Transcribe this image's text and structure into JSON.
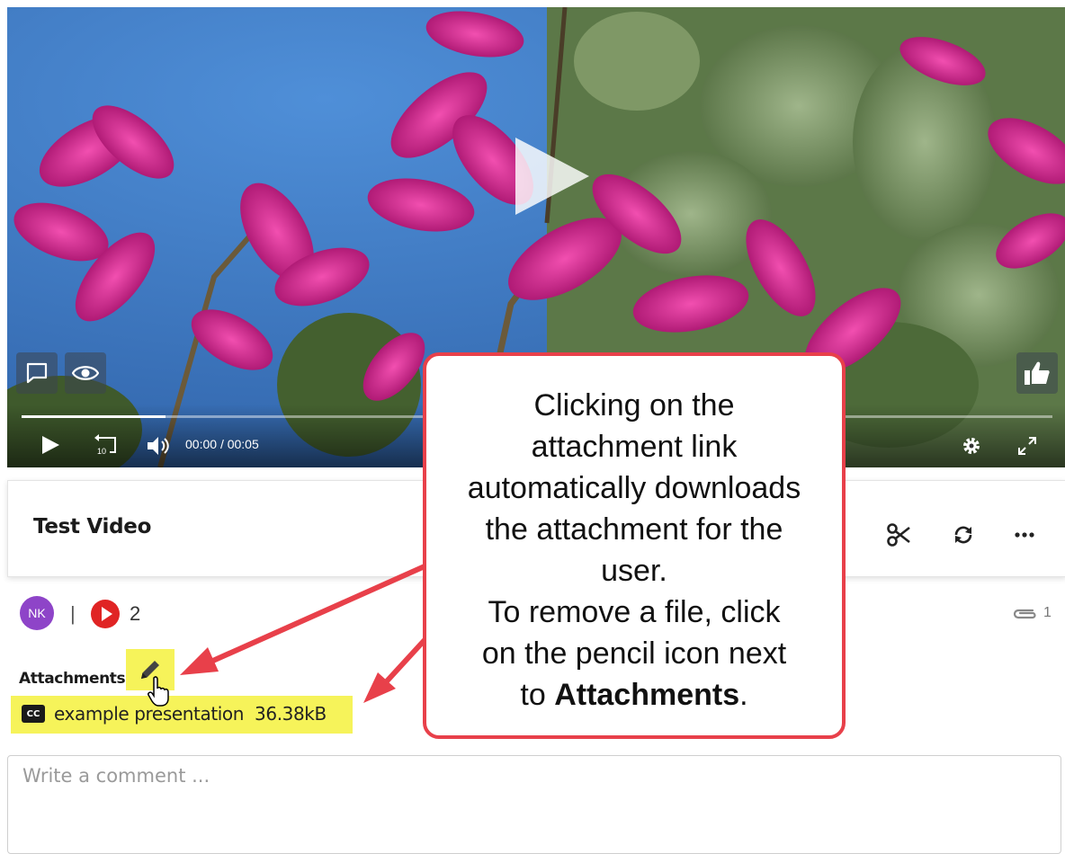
{
  "player": {
    "time_current": "00:00",
    "time_separator": "/",
    "time_total": "00:05",
    "progress": 0.14,
    "rewind_label": "10"
  },
  "video": {
    "title": "Test Video"
  },
  "meta": {
    "avatar_initials": "NK",
    "separator": "|",
    "view_count": "2",
    "attachment_count": "1"
  },
  "attachments": {
    "label": "Attachments",
    "items": [
      {
        "badge": "CC",
        "name": "example presentation",
        "size": "36.38kB"
      }
    ]
  },
  "comment": {
    "placeholder": "Write a comment ..."
  },
  "callout": {
    "lines": [
      "Clicking on the",
      "attachment link",
      "automatically downloads",
      "the attachment for the",
      "user.",
      "To remove a file, click",
      "on the pencil icon next"
    ],
    "last_line_prefix": "to ",
    "last_line_bold": "Attachments",
    "last_line_suffix": "."
  },
  "colors": {
    "highlight": "#f6f35a",
    "callout_border": "#e8404a",
    "avatar_bg": "#8e44c8",
    "views_icon": "#e02424"
  },
  "icons": {
    "big_play": "play-icon",
    "comment": "speech-bubble-icon",
    "eye": "eye-icon",
    "like": "thumbs-up-icon",
    "play": "play-icon",
    "rewind": "rewind-10-icon",
    "volume": "volume-icon",
    "settings": "gear-icon",
    "fullscreen": "fullscreen-icon",
    "scissors": "scissors-icon",
    "refresh": "refresh-icon",
    "more": "more-dots-icon",
    "paperclip": "paperclip-icon",
    "pencil": "pencil-icon",
    "cursor": "hand-cursor-icon"
  }
}
